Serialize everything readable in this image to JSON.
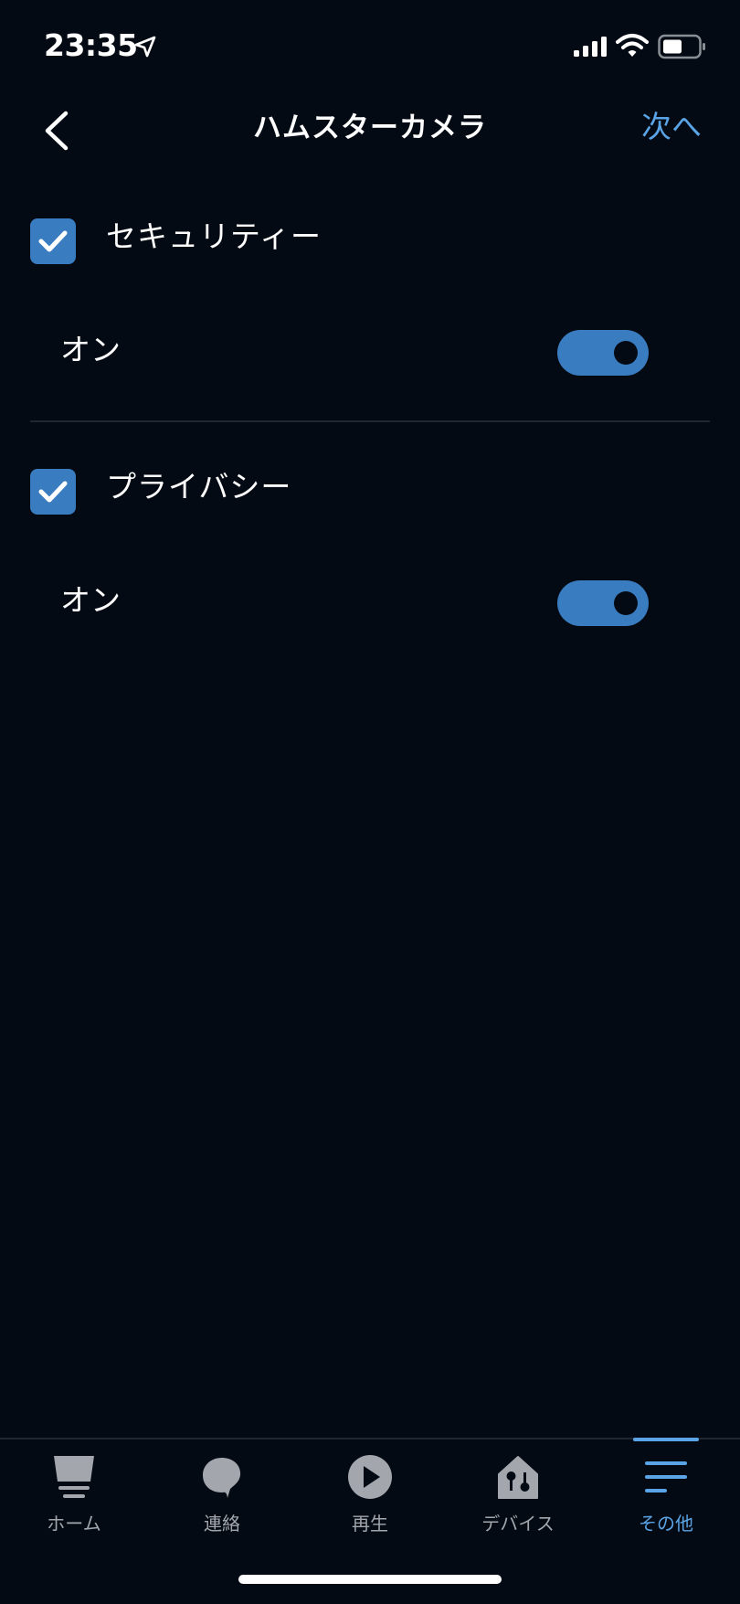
{
  "status_bar": {
    "time": "23:35",
    "icons": [
      "location-arrow-icon",
      "signal-icon",
      "wifi-icon",
      "battery-icon"
    ]
  },
  "nav": {
    "title": "ハムスターカメラ",
    "next_label": "次へ",
    "back_icon": "chevron-left-icon"
  },
  "sections": [
    {
      "title": "セキュリティー",
      "checked": true,
      "row_label": "オン",
      "toggle_on": true
    },
    {
      "title": "プライバシー",
      "checked": true,
      "row_label": "オン",
      "toggle_on": true
    }
  ],
  "tabs": [
    {
      "label": "ホーム",
      "icon": "home-icon",
      "active": false
    },
    {
      "label": "連絡",
      "icon": "chat-bubble-icon",
      "active": false
    },
    {
      "label": "再生",
      "icon": "play-icon",
      "active": false
    },
    {
      "label": "デバイス",
      "icon": "devices-icon",
      "active": false
    },
    {
      "label": "その他",
      "icon": "menu-icon",
      "active": true
    }
  ],
  "colors": {
    "background": "#040a13",
    "accent": "#3a7cc0",
    "link": "#5aa4e6",
    "tab_inactive": "#a3a7ad"
  }
}
